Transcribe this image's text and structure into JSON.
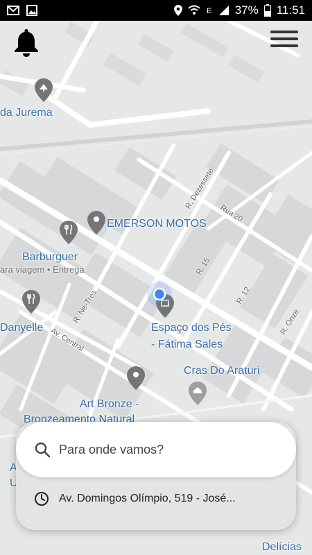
{
  "status_bar": {
    "battery": "37%",
    "time": "11:51",
    "icons": [
      "mail-icon",
      "image-icon",
      "location-icon",
      "wifi-icon",
      "data-e-icon",
      "signal-icon",
      "battery-icon"
    ]
  },
  "header": {
    "bell_icon": "bell-icon",
    "menu_icon": "hamburger-menu-icon"
  },
  "map": {
    "labels": {
      "da_jurema": "da Jurema",
      "emerson_motos": "EMERSON MOTOS",
      "barburguer": "Barburguer",
      "barburguer_sub": "ara viagem • Entrega",
      "danyelle": "Danyelle",
      "espaco_line1": "Espaço dos Pés",
      "espaco_line2": "- Fátima Sales",
      "cras": "Cras Do Araturi",
      "art_line1": "Art Bronze -",
      "art_line2": "Bronzeamento Natural",
      "delicias": "Delícias",
      "edge_a": "A",
      "edge_u": "U"
    },
    "streets": {
      "r_dezessete": "R. Dezessete",
      "rua_20": "Rua 20",
      "r_15": "R. 15",
      "r_12": "R. 12",
      "r_onze": "R. Onze",
      "r_ne_tres": "R. Ne-Tres",
      "av_central": "Av. Central"
    },
    "colors": {
      "background": "#e6e8e7",
      "road": "#ffffff",
      "building": "#d6d8da",
      "pin_gray": "#757575",
      "label_blue": "#3b6fa8",
      "location_dot": "#4285f4"
    }
  },
  "search": {
    "placeholder": "Para onde vamos?",
    "search_icon": "search-icon"
  },
  "recent": {
    "address": "Av. Domingos Olímpio, 519 - José...",
    "clock_icon": "clock-icon"
  }
}
